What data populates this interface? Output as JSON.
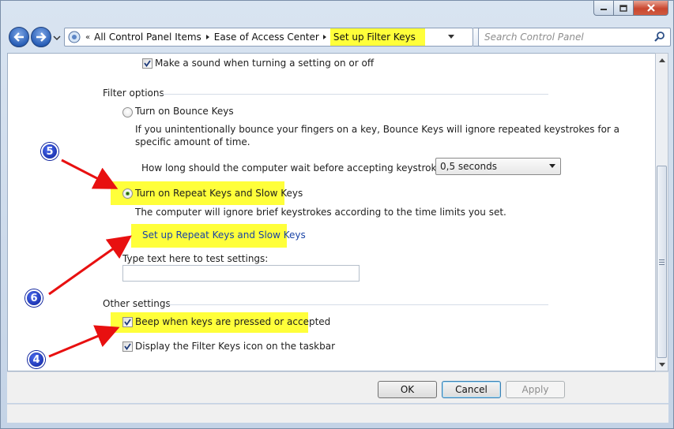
{
  "address": {
    "breadcrumbs": [
      "All Control Panel Items",
      "Ease of Access Center",
      "Set up Filter Keys"
    ],
    "overflow": "«"
  },
  "search": {
    "placeholder": "Search Control Panel"
  },
  "content": {
    "make_sound_label": "Make a sound when turning a setting on or off",
    "make_sound_checked": true,
    "filter_options_heading": "Filter options",
    "bounce_keys_label": "Turn on Bounce Keys",
    "bounce_keys_desc_line1": "If you unintentionally bounce your fingers on a key, Bounce Keys will ignore repeated keystrokes for a",
    "bounce_keys_desc_line2": "specific amount of time.",
    "wait_question": "How long should the computer wait before accepting keystrokes?",
    "wait_value": "0,5 seconds",
    "repeat_keys_label": "Turn on Repeat Keys and Slow Keys",
    "repeat_keys_selected": true,
    "repeat_keys_desc": "The computer will ignore brief keystrokes according to the time limits you set.",
    "repeat_keys_link": "Set up Repeat Keys and Slow Keys",
    "test_label": "Type text here to test settings:",
    "other_settings_heading": "Other settings",
    "beep_label": "Beep when keys are pressed or accepted",
    "beep_checked": true,
    "display_icon_label": "Display the Filter Keys icon on the taskbar",
    "display_icon_checked": true
  },
  "buttons": {
    "ok": "OK",
    "cancel": "Cancel",
    "apply": "Apply"
  },
  "annotations": [
    {
      "number": "5"
    },
    {
      "number": "6"
    },
    {
      "number": "4"
    }
  ],
  "colors": {
    "highlight": "#ffff3a",
    "arrow": "#e81010",
    "badge": "#0a1f9a",
    "link": "#1a44a6"
  }
}
